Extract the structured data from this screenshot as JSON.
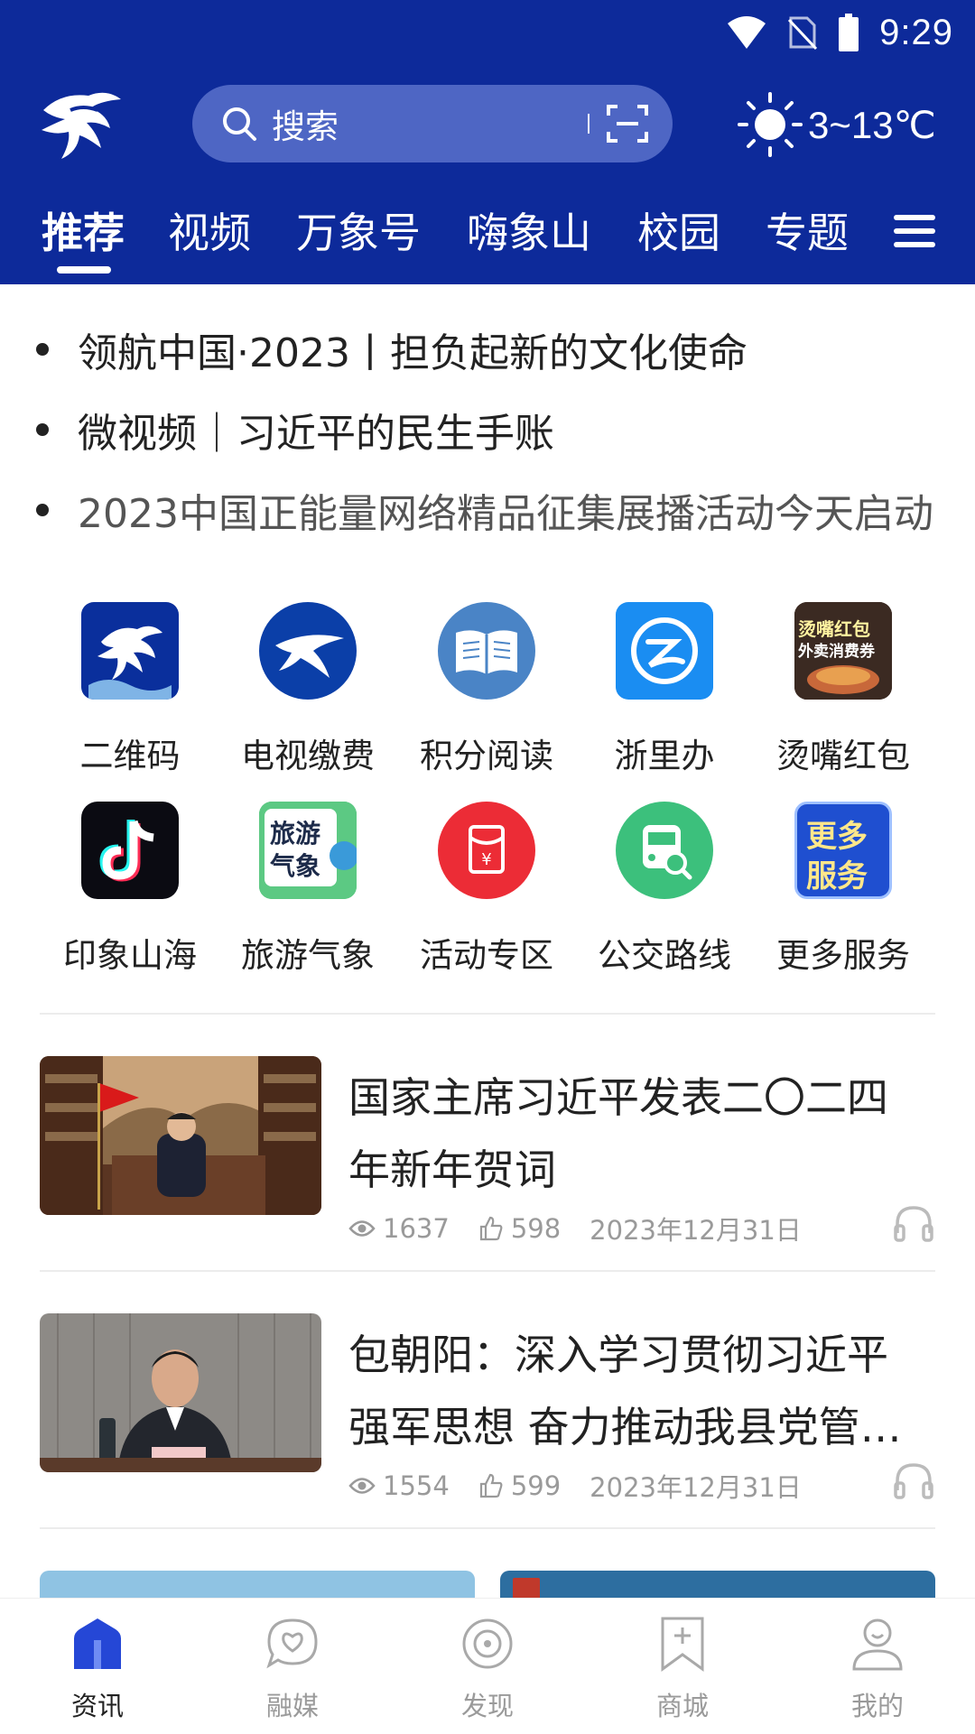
{
  "status": {
    "time": "9:29"
  },
  "search": {
    "placeholder": "搜索"
  },
  "weather": {
    "text": "3~13℃"
  },
  "tabs": [
    "推荐",
    "视频",
    "万象号",
    "嗨象山",
    "校园",
    "专题"
  ],
  "headlines": [
    "领航中国·2023丨担负起新的文化使命",
    "微视频｜习近平的民生手账",
    "2023中国正能量网络精品征集展播活动今天启动"
  ],
  "services": [
    {
      "label": "二维码",
      "icon": "xiang-logo-icon"
    },
    {
      "label": "电视缴费",
      "icon": "tv-bird-icon"
    },
    {
      "label": "积分阅读",
      "icon": "book-icon"
    },
    {
      "label": "浙里办",
      "icon": "zheliban-icon"
    },
    {
      "label": "烫嘴红包",
      "icon": "red-packet-promo-icon"
    },
    {
      "label": "印象山海",
      "icon": "tiktok-icon"
    },
    {
      "label": "旅游气象",
      "icon": "travel-weather-icon"
    },
    {
      "label": "活动专区",
      "icon": "red-envelope-icon"
    },
    {
      "label": "公交路线",
      "icon": "bus-icon"
    },
    {
      "label": "更多服务",
      "icon": "more-services-icon"
    }
  ],
  "service_badges": {
    "promo_top": "烫嘴红包",
    "promo_bottom": "外卖消费券",
    "travel_line1": "旅游",
    "travel_line2": "气象",
    "more_line1": "更多",
    "more_line2": "服务"
  },
  "news": [
    {
      "title": "国家主席习近平发表二〇二四年新年贺词",
      "views": "1637",
      "likes": "598",
      "date": "2023年12月31日"
    },
    {
      "title": "包朝阳：深入学习贯彻习近平强军思想 奋力推动我县党管武装工作",
      "views": "1554",
      "likes": "599",
      "date": "2023年12月31日"
    }
  ],
  "bottom_nav": [
    {
      "label": "资讯",
      "icon": "home-icon",
      "active": true
    },
    {
      "label": "融媒",
      "icon": "heart-chat-icon",
      "active": false
    },
    {
      "label": "发现",
      "icon": "disc-icon",
      "active": false
    },
    {
      "label": "商城",
      "icon": "bookmark-plus-icon",
      "active": false
    },
    {
      "label": "我的",
      "icon": "user-icon",
      "active": false
    }
  ],
  "colors": {
    "header": "#0d2a9a",
    "search": "#4e66c4",
    "accent": "#2547d6"
  }
}
